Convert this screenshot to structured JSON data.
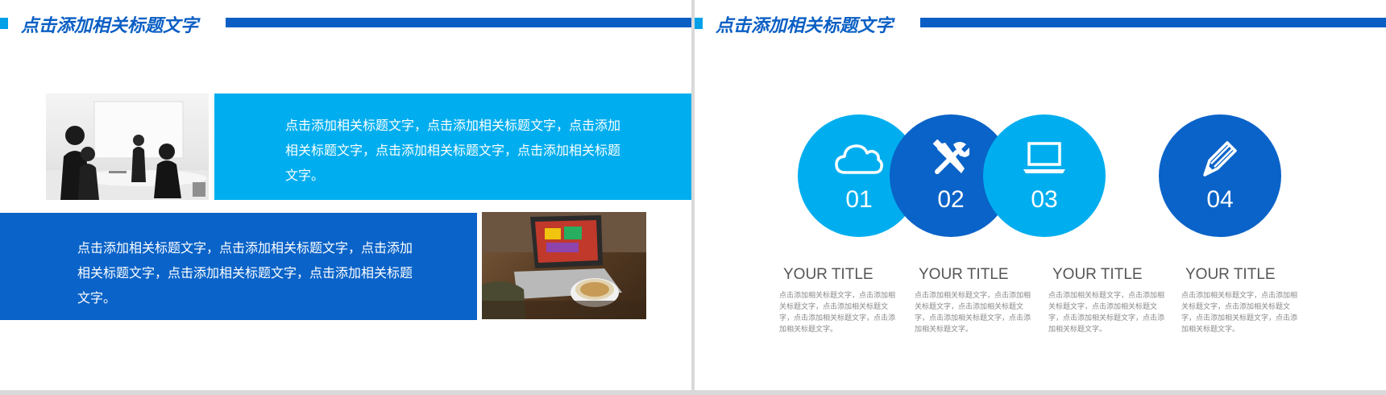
{
  "left_slide": {
    "title": "点击添加相关标题文字",
    "block_cyan_text": "点击添加相关标题文字，点击添加相关标题文字，点击添加相关标题文字，点击添加相关标题文字，点击添加相关标题文字。",
    "block_blue_text": "点击添加相关标题文字，点击添加相关标题文字，点击添加相关标题文字，点击添加相关标题文字，点击添加相关标题文字。"
  },
  "right_slide": {
    "title": "点击添加相关标题文字",
    "items": [
      {
        "number": "01",
        "icon": "cloud-icon",
        "title": "YOUR TITLE",
        "body": "点击添加相关标题文字，点击添加相关标题文字，点击添加相关标题文字，点击添加相关标题文字，点击添加相关标题文字。"
      },
      {
        "number": "02",
        "icon": "tools-icon",
        "title": "YOUR TITLE",
        "body": "点击添加相关标题文字，点击添加相关标题文字，点击添加相关标题文字，点击添加相关标题文字，点击添加相关标题文字。"
      },
      {
        "number": "03",
        "icon": "laptop-icon",
        "title": "YOUR TITLE",
        "body": "点击添加相关标题文字，点击添加相关标题文字，点击添加相关标题文字，点击添加相关标题文字，点击添加相关标题文字。"
      },
      {
        "number": "04",
        "icon": "pencil-icon",
        "title": "YOUR TITLE",
        "body": "点击添加相关标题文字，点击添加相关标题文字，点击添加相关标题文字，点击添加相关标题文字，点击添加相关标题文字。"
      }
    ]
  },
  "colors": {
    "accent_blue": "#0a63c8",
    "accent_cyan": "#00aeef",
    "title_blue": "#0b5fc4"
  }
}
